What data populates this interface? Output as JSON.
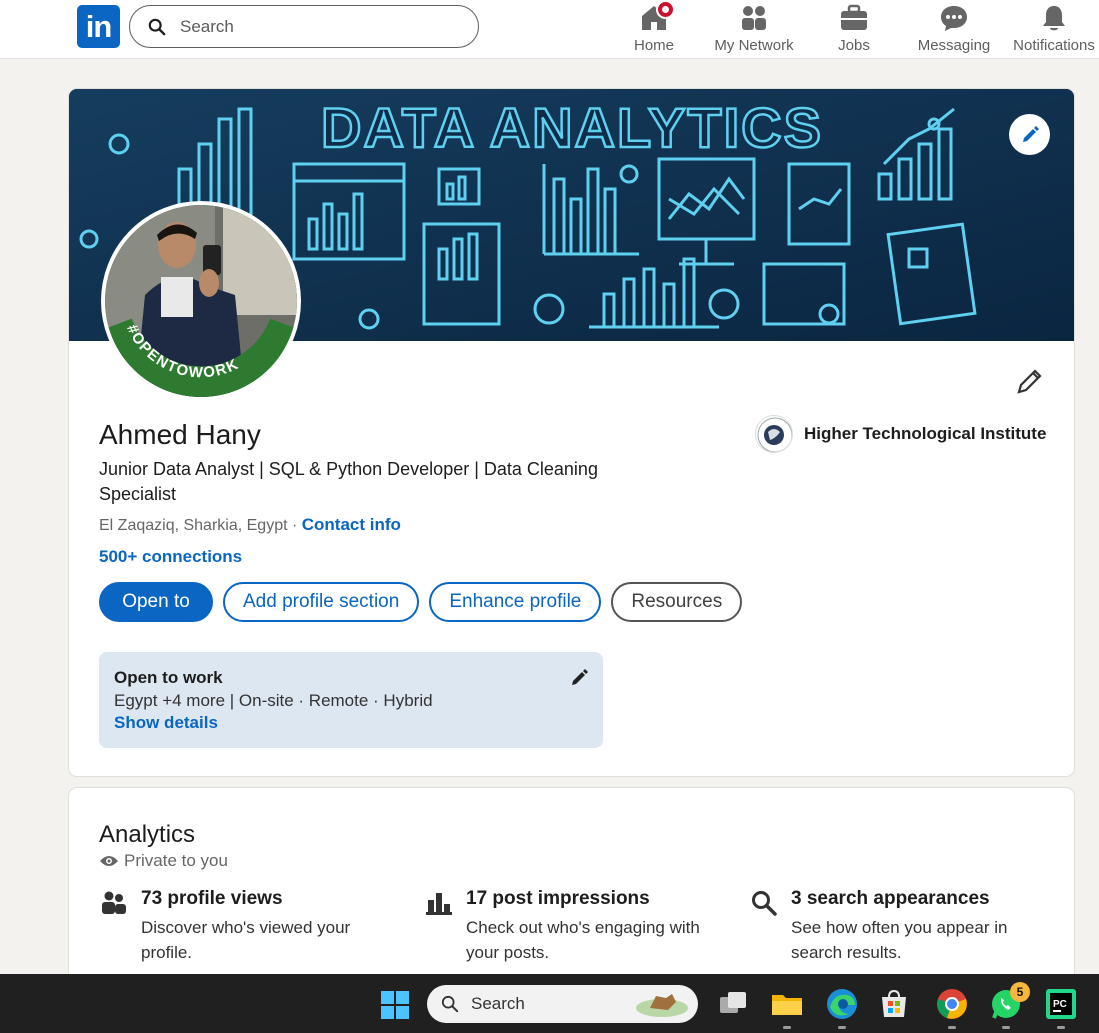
{
  "nav": {
    "search_placeholder": "Search",
    "items": [
      {
        "label": "Home",
        "icon": "home-icon"
      },
      {
        "label": "My Network",
        "icon": "network-icon"
      },
      {
        "label": "Jobs",
        "icon": "briefcase-icon"
      },
      {
        "label": "Messaging",
        "icon": "messaging-icon"
      },
      {
        "label": "Notifications",
        "icon": "bell-icon"
      }
    ]
  },
  "banner": {
    "heading": "DATA ANALYTICS"
  },
  "profile": {
    "name": "Ahmed Hany",
    "headline": "Junior Data Analyst | SQL & Python Developer | Data Cleaning Specialist",
    "location": "El Zaqaziq, Sharkia, Egypt",
    "location_sep": " · ",
    "contact_info": "Contact info",
    "connections": "500+ connections",
    "avatar_frame_text": "#OPENTOWORK",
    "organization": "Higher Technological Institute",
    "buttons": {
      "open_to": "Open to",
      "add_section": "Add profile section",
      "enhance": "Enhance profile",
      "resources": "Resources"
    },
    "open_to_work": {
      "title": "Open to work",
      "details": "Egypt +4 more | On-site · Remote · Hybrid",
      "link": "Show details"
    }
  },
  "analytics": {
    "title": "Analytics",
    "privacy": "Private to you",
    "items": [
      {
        "headline": "73 profile views",
        "desc": "Discover who's viewed your profile.",
        "icon": "people-icon"
      },
      {
        "headline": "17 post impressions",
        "desc": "Check out who's engaging with your posts.",
        "icon": "bar-chart-icon"
      },
      {
        "headline": "3 search appearances",
        "desc": "See how often you appear in search results.",
        "icon": "magnifier-icon"
      }
    ]
  },
  "taskbar": {
    "search_label": "Search",
    "whatsapp_badge": "5"
  },
  "colors": {
    "linkedin_blue": "#0a66c2",
    "page_bg": "#f4f2ee",
    "open_to_work_green": "#2f7a31",
    "banner_bg": "#0d2d4a",
    "banner_line": "#5fd0f0"
  }
}
